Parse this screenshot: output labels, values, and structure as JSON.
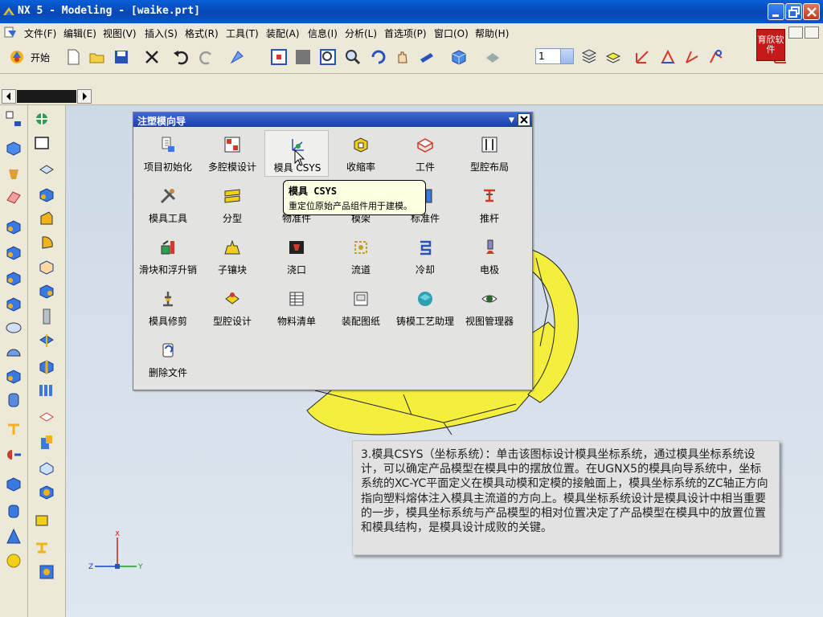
{
  "window": {
    "title": "NX 5 - Modeling - [waike.prt]"
  },
  "menubar": {
    "items": [
      "文件(F)",
      "编辑(E)",
      "视图(V)",
      "插入(S)",
      "格式(R)",
      "工具(T)",
      "装配(A)",
      "信息(I)",
      "分析(L)",
      "首选项(P)",
      "窗口(O)",
      "帮助(H)"
    ],
    "brand_logo_text": "育欣软件"
  },
  "toolbar": {
    "start_label": "开始",
    "layer_value": "1"
  },
  "dialog": {
    "title": "注塑模向导",
    "tools": [
      {
        "label": "项目初始化",
        "icon": "project-init-icon"
      },
      {
        "label": "多腔模设计",
        "icon": "multi-cavity-icon"
      },
      {
        "label": "模具 CSYS",
        "icon": "mold-csys-icon"
      },
      {
        "label": "收缩率",
        "icon": "shrinkage-icon"
      },
      {
        "label": "工件",
        "icon": "workpiece-icon"
      },
      {
        "label": "型腔布局",
        "icon": "cavity-layout-icon"
      },
      {
        "label": "模具工具",
        "icon": "mold-tools-icon"
      },
      {
        "label": "分型",
        "icon": "parting-icon"
      },
      {
        "label": "物准件",
        "icon": "standard-part-icon"
      },
      {
        "label": "模架",
        "icon": "mold-base-icon"
      },
      {
        "label": "标准件",
        "icon": "standard-lib-icon"
      },
      {
        "label": "推杆",
        "icon": "ejector-pin-icon"
      },
      {
        "label": "滑块和浮升销",
        "icon": "slider-lifter-icon"
      },
      {
        "label": "子镶块",
        "icon": "sub-insert-icon"
      },
      {
        "label": "浇口",
        "icon": "gate-icon"
      },
      {
        "label": "流道",
        "icon": "runner-icon"
      },
      {
        "label": "冷却",
        "icon": "cooling-icon"
      },
      {
        "label": "电极",
        "icon": "electrode-icon"
      },
      {
        "label": "模具修剪",
        "icon": "mold-trim-icon"
      },
      {
        "label": "型腔设计",
        "icon": "cavity-design-icon"
      },
      {
        "label": "物料清单",
        "icon": "bom-icon"
      },
      {
        "label": "装配图纸",
        "icon": "assembly-drawing-icon"
      },
      {
        "label": "铸模工艺助理",
        "icon": "casting-assistant-icon"
      },
      {
        "label": "视图管理器",
        "icon": "view-manager-icon"
      },
      {
        "label": "删除文件",
        "icon": "delete-file-icon"
      }
    ]
  },
  "tooltip": {
    "title": "模具 CSYS",
    "body": "重定位原始产品组件用于建模。"
  },
  "explanation": {
    "text": "3.模具CSYS（坐标系统）：单击该图标设计模具坐标系统，通过模具坐标系统设计，可以确定产品模型在模具中的摆放位置。在UGNX5的模具向导系统中，坐标系统的XC-YC平面定义在模具动模和定模的接触面上，模具坐标系统的ZC轴正方向指向塑料熔体注入模具主流道的方向上。模具坐标系统设计是模具设计中相当重要的一步，模具坐标系统与产品模型的相对位置决定了产品模型在模具中的放置位置和模具结构，是模具设计成败的关键。"
  },
  "triad": {
    "x_label": "X",
    "y_label": "Y",
    "z_label": "Z"
  },
  "colors": {
    "titlebar": "#0a5fd8",
    "dialog_title": "#2a52be",
    "model_yellow": "#f2ee3a",
    "tooltip_bg": "#ffffe1"
  }
}
